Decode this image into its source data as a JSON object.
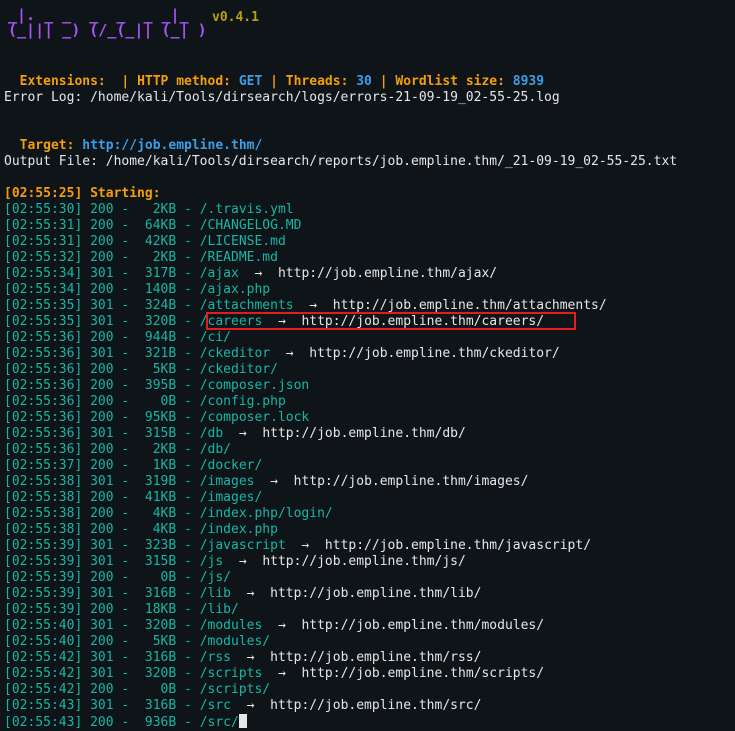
{
  "banner": {
    "logo_top": "_|. _ _  _  _  _ _|_",
    "logo_bottom": "(_||| _) (/_(_|| (_| )",
    "version": "v0.4.1"
  },
  "config": {
    "ext_label": "Extensions:",
    "ext_value": "",
    "method_label": "HTTP method:",
    "method_value": "GET",
    "threads_label": "Threads:",
    "threads_value": "30",
    "wordlist_label": "Wordlist size:",
    "wordlist_value": "8939",
    "sep": "|"
  },
  "error_log": "Error Log: /home/kali/Tools/dirsearch/logs/errors-21-09-19_02-55-25.log",
  "target": {
    "label": "Target:",
    "value": "http://job.empline.thm/"
  },
  "output_file": "Output File: /home/kali/Tools/dirsearch/reports/job.empline.thm/_21-09-19_02-55-25.txt",
  "starting": "[02:55:25] Starting:",
  "results": [
    {
      "time": "[02:55:30]",
      "code": "200",
      "size": "2KB",
      "path": "/.travis.yml",
      "redirect": ""
    },
    {
      "time": "[02:55:31]",
      "code": "200",
      "size": "64KB",
      "path": "/CHANGELOG.MD",
      "redirect": ""
    },
    {
      "time": "[02:55:31]",
      "code": "200",
      "size": "42KB",
      "path": "/LICENSE.md",
      "redirect": ""
    },
    {
      "time": "[02:55:32]",
      "code": "200",
      "size": "2KB",
      "path": "/README.md",
      "redirect": ""
    },
    {
      "time": "[02:55:34]",
      "code": "301",
      "size": "317B",
      "path": "/ajax",
      "redirect": "http://job.empline.thm/ajax/"
    },
    {
      "time": "[02:55:34]",
      "code": "200",
      "size": "140B",
      "path": "/ajax.php",
      "redirect": ""
    },
    {
      "time": "[02:55:35]",
      "code": "301",
      "size": "324B",
      "path": "/attachments",
      "redirect": "http://job.empline.thm/attachments/"
    },
    {
      "time": "[02:55:35]",
      "code": "301",
      "size": "320B",
      "path": "/careers",
      "redirect": "http://job.empline.thm/careers/"
    },
    {
      "time": "[02:55:36]",
      "code": "200",
      "size": "944B",
      "path": "/ci/",
      "redirect": ""
    },
    {
      "time": "[02:55:36]",
      "code": "301",
      "size": "321B",
      "path": "/ckeditor",
      "redirect": "http://job.empline.thm/ckeditor/"
    },
    {
      "time": "[02:55:36]",
      "code": "200",
      "size": "5KB",
      "path": "/ckeditor/",
      "redirect": ""
    },
    {
      "time": "[02:55:36]",
      "code": "200",
      "size": "395B",
      "path": "/composer.json",
      "redirect": ""
    },
    {
      "time": "[02:55:36]",
      "code": "200",
      "size": "0B",
      "path": "/config.php",
      "redirect": ""
    },
    {
      "time": "[02:55:36]",
      "code": "200",
      "size": "95KB",
      "path": "/composer.lock",
      "redirect": ""
    },
    {
      "time": "[02:55:36]",
      "code": "301",
      "size": "315B",
      "path": "/db",
      "redirect": "http://job.empline.thm/db/"
    },
    {
      "time": "[02:55:36]",
      "code": "200",
      "size": "2KB",
      "path": "/db/",
      "redirect": ""
    },
    {
      "time": "[02:55:37]",
      "code": "200",
      "size": "1KB",
      "path": "/docker/",
      "redirect": ""
    },
    {
      "time": "[02:55:38]",
      "code": "301",
      "size": "319B",
      "path": "/images",
      "redirect": "http://job.empline.thm/images/"
    },
    {
      "time": "[02:55:38]",
      "code": "200",
      "size": "41KB",
      "path": "/images/",
      "redirect": ""
    },
    {
      "time": "[02:55:38]",
      "code": "200",
      "size": "4KB",
      "path": "/index.php/login/",
      "redirect": ""
    },
    {
      "time": "[02:55:38]",
      "code": "200",
      "size": "4KB",
      "path": "/index.php",
      "redirect": ""
    },
    {
      "time": "[02:55:39]",
      "code": "301",
      "size": "323B",
      "path": "/javascript",
      "redirect": "http://job.empline.thm/javascript/"
    },
    {
      "time": "[02:55:39]",
      "code": "301",
      "size": "315B",
      "path": "/js",
      "redirect": "http://job.empline.thm/js/"
    },
    {
      "time": "[02:55:39]",
      "code": "200",
      "size": "0B",
      "path": "/js/",
      "redirect": ""
    },
    {
      "time": "[02:55:39]",
      "code": "301",
      "size": "316B",
      "path": "/lib",
      "redirect": "http://job.empline.thm/lib/"
    },
    {
      "time": "[02:55:39]",
      "code": "200",
      "size": "18KB",
      "path": "/lib/",
      "redirect": ""
    },
    {
      "time": "[02:55:40]",
      "code": "301",
      "size": "320B",
      "path": "/modules",
      "redirect": "http://job.empline.thm/modules/"
    },
    {
      "time": "[02:55:40]",
      "code": "200",
      "size": "5KB",
      "path": "/modules/",
      "redirect": ""
    },
    {
      "time": "[02:55:42]",
      "code": "301",
      "size": "316B",
      "path": "/rss",
      "redirect": "http://job.empline.thm/rss/"
    },
    {
      "time": "[02:55:42]",
      "code": "301",
      "size": "320B",
      "path": "/scripts",
      "redirect": "http://job.empline.thm/scripts/"
    },
    {
      "time": "[02:55:42]",
      "code": "200",
      "size": "0B",
      "path": "/scripts/",
      "redirect": ""
    },
    {
      "time": "[02:55:43]",
      "code": "301",
      "size": "316B",
      "path": "/src",
      "redirect": "http://job.empline.thm/src/"
    },
    {
      "time": "[02:55:43]",
      "code": "200",
      "size": "936B",
      "path": "/src/",
      "redirect": ""
    }
  ],
  "colors": {
    "background": "#0f1419",
    "orange": "#f59e0b",
    "blue": "#3b9fe8",
    "teal": "#14b8a6",
    "highlight": "#e11d1d",
    "logo": "#a855f7"
  }
}
